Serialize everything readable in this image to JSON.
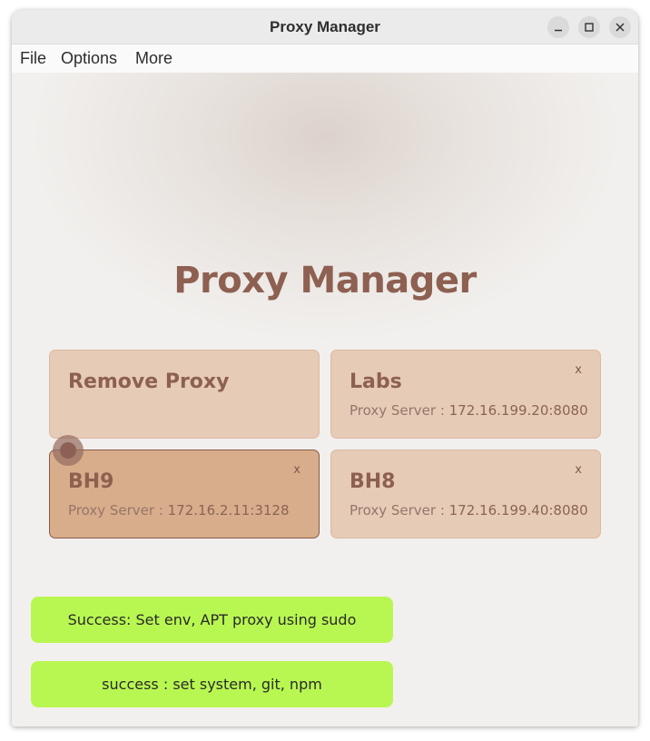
{
  "window": {
    "title": "Proxy Manager"
  },
  "menu": {
    "file": "File",
    "options": "Options",
    "more": "More"
  },
  "main": {
    "heading": "Proxy Manager",
    "remove_card": {
      "title": "Remove Proxy"
    },
    "proxies": [
      {
        "name": "Labs",
        "label": "Proxy Server : ",
        "server": "172.16.199.20:8080",
        "close": "x"
      },
      {
        "name": "BH9",
        "label": "Proxy Server : ",
        "server": "172.16.2.11:3128",
        "close": "x",
        "active": true
      },
      {
        "name": "BH8",
        "label": "Proxy Server : ",
        "server": "172.16.199.40:8080",
        "close": "x"
      }
    ]
  },
  "notifications": [
    {
      "text": "Success: Set env, APT proxy using sudo"
    },
    {
      "text": "success : set system, git, npm"
    }
  ],
  "colors": {
    "accent": "#8d6051",
    "card": "#e6cbb7",
    "card_active": "#d8ad8b",
    "toast": "#b8f751"
  },
  "icons": {
    "minimize": "minimize-icon",
    "maximize": "maximize-icon",
    "close": "close-icon"
  }
}
